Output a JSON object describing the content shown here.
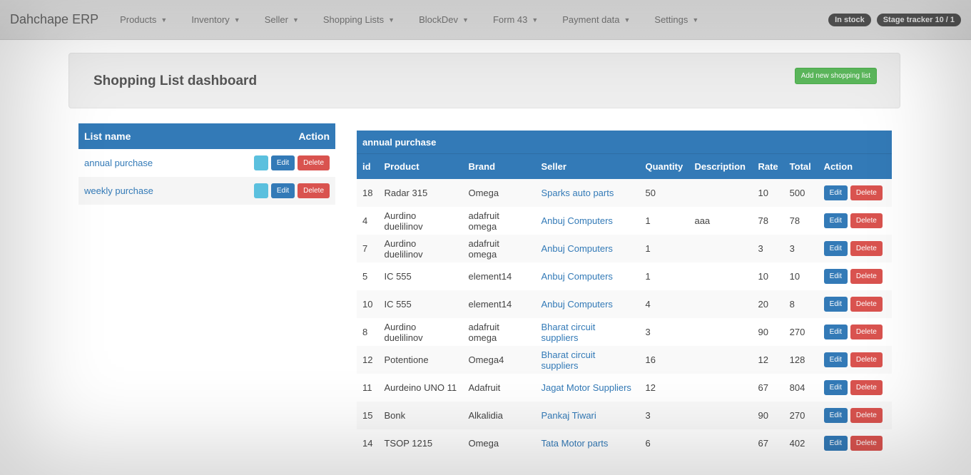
{
  "navbar": {
    "brand": "Dahchape ERP",
    "items": [
      {
        "label": "Products"
      },
      {
        "label": "Inventory"
      },
      {
        "label": "Seller"
      },
      {
        "label": "Shopping Lists"
      },
      {
        "label": "BlockDev"
      },
      {
        "label": "Form 43"
      },
      {
        "label": "Payment data"
      },
      {
        "label": "Settings"
      }
    ],
    "badges": [
      "In stock",
      "Stage tracker 10 / 1"
    ]
  },
  "page": {
    "title": "Shopping List dashboard",
    "add_button": "Add new shopping list"
  },
  "lists": {
    "header_name": "List name",
    "header_action": "Action",
    "info_label": "",
    "edit_label": "Edit",
    "delete_label": "Delete",
    "rows": [
      {
        "name": "annual purchase"
      },
      {
        "name": "weekly purchase"
      }
    ]
  },
  "table": {
    "title": "annual purchase",
    "columns": [
      "id",
      "Product",
      "Brand",
      "Seller",
      "Quantity",
      "Description",
      "Rate",
      "Total",
      "Action"
    ],
    "edit_label": "Edit",
    "delete_label": "Delete",
    "rows": [
      {
        "id": "18",
        "product": "Radar 315",
        "brand": "Omega",
        "seller": "Sparks auto parts",
        "quantity": "50",
        "description": "",
        "rate": "10",
        "total": "500"
      },
      {
        "id": "4",
        "product": "Aurdino duelilinov",
        "brand": "adafruit omega",
        "seller": "Anbuj Computers",
        "quantity": "1",
        "description": "aaa",
        "rate": "78",
        "total": "78"
      },
      {
        "id": "7",
        "product": "Aurdino duelilinov",
        "brand": "adafruit omega",
        "seller": "Anbuj Computers",
        "quantity": "1",
        "description": "",
        "rate": "3",
        "total": "3"
      },
      {
        "id": "5",
        "product": "IC 555",
        "brand": "element14",
        "seller": "Anbuj Computers",
        "quantity": "1",
        "description": "",
        "rate": "10",
        "total": "10"
      },
      {
        "id": "10",
        "product": "IC 555",
        "brand": "element14",
        "seller": "Anbuj Computers",
        "quantity": "4",
        "description": "",
        "rate": "20",
        "total": "8"
      },
      {
        "id": "8",
        "product": "Aurdino duelilinov",
        "brand": "adafruit omega",
        "seller": "Bharat circuit suppliers",
        "quantity": "3",
        "description": "",
        "rate": "90",
        "total": "270"
      },
      {
        "id": "12",
        "product": "Potentione",
        "brand": "Omega4",
        "seller": "Bharat circuit suppliers",
        "quantity": "16",
        "description": "",
        "rate": "12",
        "total": "128"
      },
      {
        "id": "11",
        "product": "Aurdeino UNO 11",
        "brand": "Adafruit",
        "seller": "Jagat Motor Suppliers",
        "quantity": "12",
        "description": "",
        "rate": "67",
        "total": "804"
      },
      {
        "id": "15",
        "product": "Bonk",
        "brand": "Alkalidia",
        "seller": "Pankaj Tiwari",
        "quantity": "3",
        "description": "",
        "rate": "90",
        "total": "270"
      },
      {
        "id": "14",
        "product": "TSOP 1215",
        "brand": "Omega",
        "seller": "Tata Motor parts",
        "quantity": "6",
        "description": "",
        "rate": "67",
        "total": "402"
      }
    ]
  }
}
